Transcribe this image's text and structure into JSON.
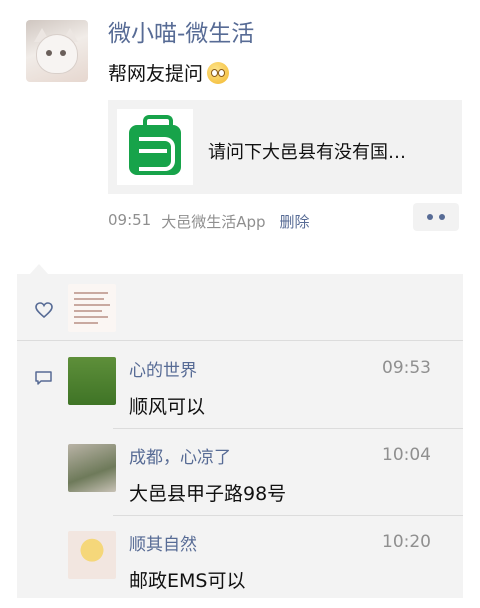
{
  "post": {
    "author": "微小喵-微生活",
    "text": "帮网友提问",
    "emoji_icon": "thinking-face-icon",
    "link": {
      "title": "请问下大邑县有没有国…",
      "thumb_icon": "green-shopping-bag-logo"
    },
    "time": "09:51",
    "source": "大邑微生活App",
    "delete_label": "删除"
  },
  "colors": {
    "name_blue": "#576b95",
    "panel_bg": "#f3f3f3",
    "muted": "#8f8f8f"
  },
  "comments": [
    {
      "name": "心的世界",
      "time": "09:53",
      "text": "顺风可以"
    },
    {
      "name": "成都，心凉了",
      "time": "10:04",
      "text": "大邑县甲子路98号"
    },
    {
      "name": "顺其自然",
      "time": "10:20",
      "text": "邮政EMS可以"
    }
  ]
}
